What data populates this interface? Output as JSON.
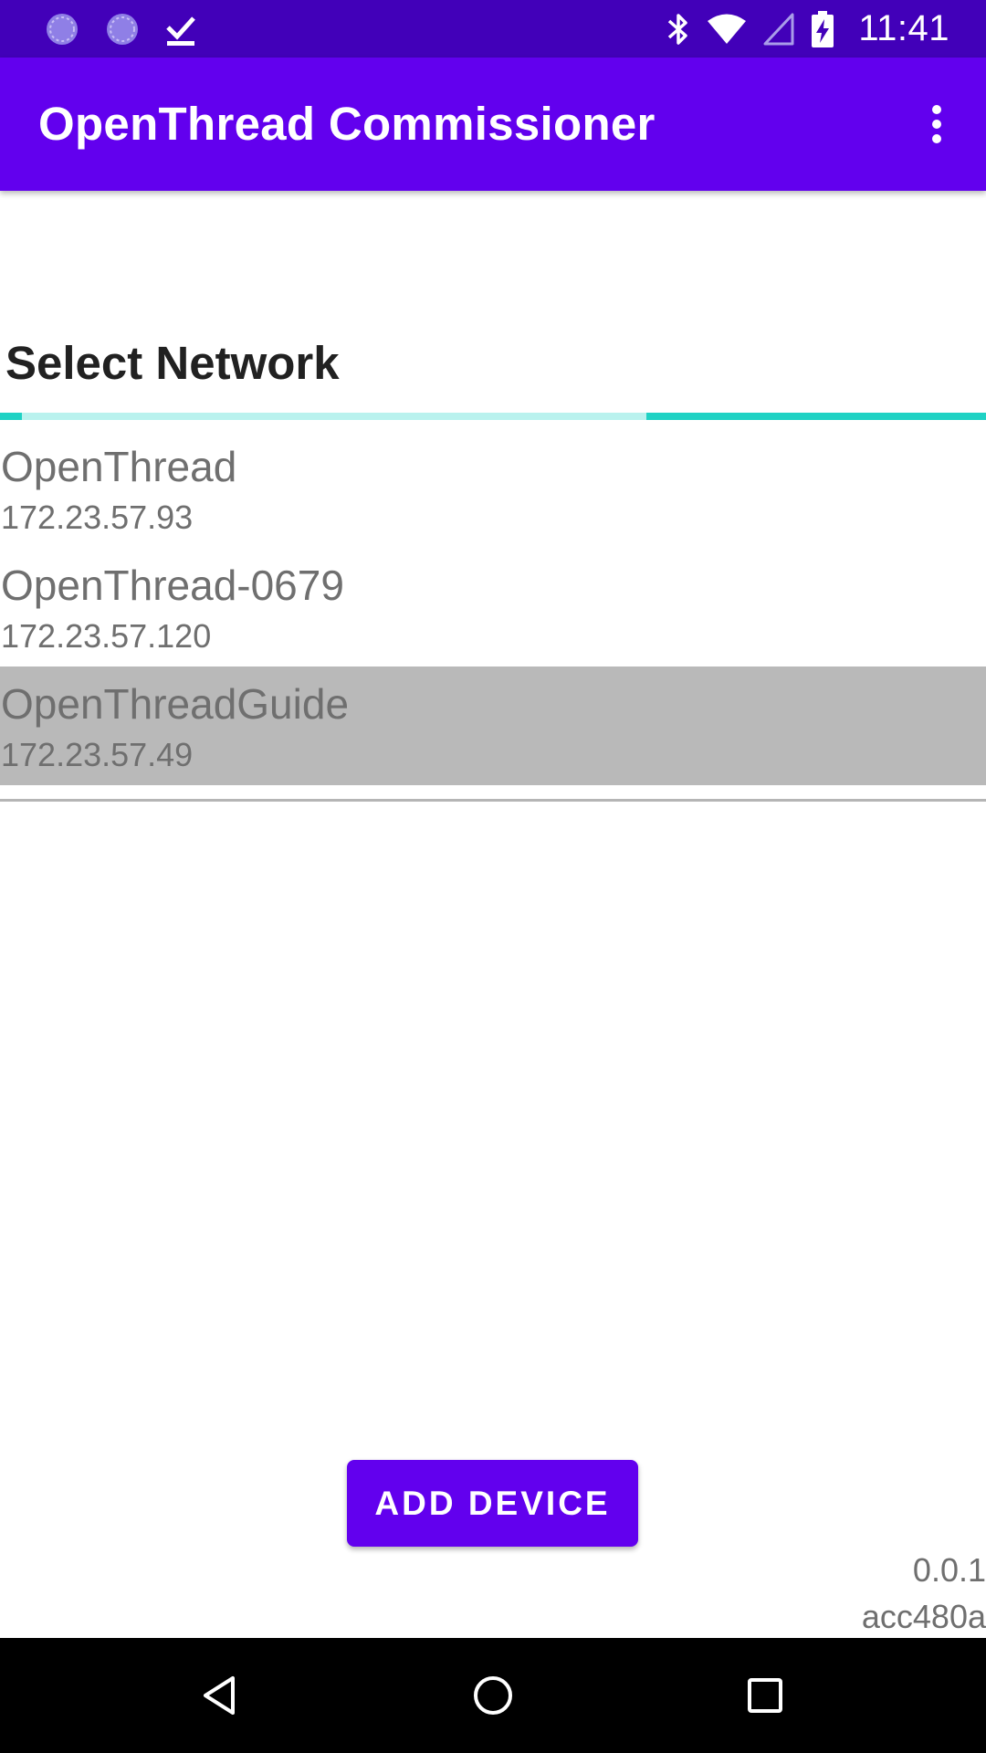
{
  "status_bar": {
    "time": "11:41",
    "left_icons": [
      "sync-icon",
      "sync-icon",
      "download-done-icon"
    ],
    "right_icons": [
      "bluetooth-icon",
      "wifi-icon",
      "cellular-signal-icon",
      "battery-charging-icon"
    ]
  },
  "app_bar": {
    "title": "OpenThread Commissioner",
    "menu_icon": "more-vert-icon",
    "color": "#6200ee"
  },
  "section": {
    "title": "Select Network",
    "accent_color": "#1fd2c4"
  },
  "networks": [
    {
      "name": "OpenThread",
      "address": "172.23.57.93",
      "selected": false
    },
    {
      "name": "OpenThread-0679",
      "address": "172.23.57.120",
      "selected": false
    },
    {
      "name": "OpenThreadGuide",
      "address": "172.23.57.49",
      "selected": true
    }
  ],
  "actions": {
    "add_device_label": "ADD DEVICE"
  },
  "version": {
    "number": "0.0.1",
    "commit": "acc480a"
  },
  "nav_bar": {
    "buttons": [
      "back-icon",
      "home-icon",
      "recents-icon"
    ]
  }
}
